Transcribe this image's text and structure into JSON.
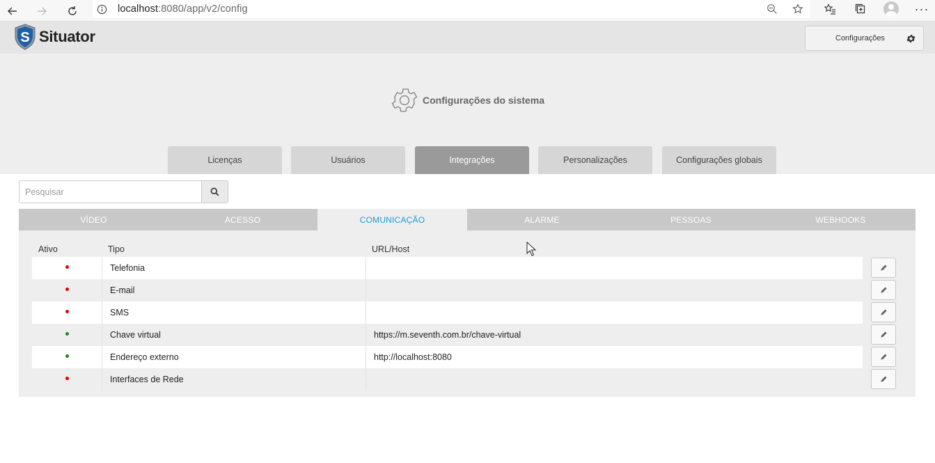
{
  "browser": {
    "url_host": "localhost",
    "url_path": ":8080/app/v2/config"
  },
  "header": {
    "logo_text": "Situator",
    "config_button_label": "Configurações"
  },
  "hero": {
    "title": "Configurações do sistema"
  },
  "main_tabs": [
    {
      "label": "Licenças",
      "active": false
    },
    {
      "label": "Usuários",
      "active": false
    },
    {
      "label": "Integrações",
      "active": true
    },
    {
      "label": "Personalizações",
      "active": false
    },
    {
      "label": "Configurações globais",
      "active": false
    }
  ],
  "search": {
    "placeholder": "Pesquisar",
    "value": ""
  },
  "sub_tabs": [
    {
      "label": "VÍDEO",
      "active": false
    },
    {
      "label": "ACESSO",
      "active": false
    },
    {
      "label": "COMUNICAÇÃO",
      "active": true
    },
    {
      "label": "ALARME",
      "active": false
    },
    {
      "label": "PESSOAS",
      "active": false
    },
    {
      "label": "WEBHOOKS",
      "active": false
    }
  ],
  "table": {
    "headers": {
      "active": "Ativo",
      "type": "Tipo",
      "url": "URL/Host"
    },
    "rows": [
      {
        "active": false,
        "type": "Telefonia",
        "url": ""
      },
      {
        "active": false,
        "type": "E-mail",
        "url": ""
      },
      {
        "active": false,
        "type": "SMS",
        "url": ""
      },
      {
        "active": true,
        "type": "Chave virtual",
        "url": "https://m.seventh.com.br/chave-virtual"
      },
      {
        "active": true,
        "type": "Endereço externo",
        "url": "http://localhost:8080"
      },
      {
        "active": false,
        "type": "Interfaces de Rede",
        "url": ""
      }
    ]
  },
  "colors": {
    "active_subtab_text": "#1b9bd7",
    "status_on": "#1e8a1e",
    "status_off": "#e60000",
    "active_main_tab_bg": "#9a9a9a"
  },
  "icons": [
    "back-icon",
    "forward-icon",
    "refresh-icon",
    "info-icon",
    "zoom-icon",
    "star-icon",
    "favorites-icon",
    "collections-icon",
    "profile-icon",
    "more-icon",
    "shield-logo-icon",
    "gear-icon",
    "search-icon",
    "pencil-icon"
  ]
}
